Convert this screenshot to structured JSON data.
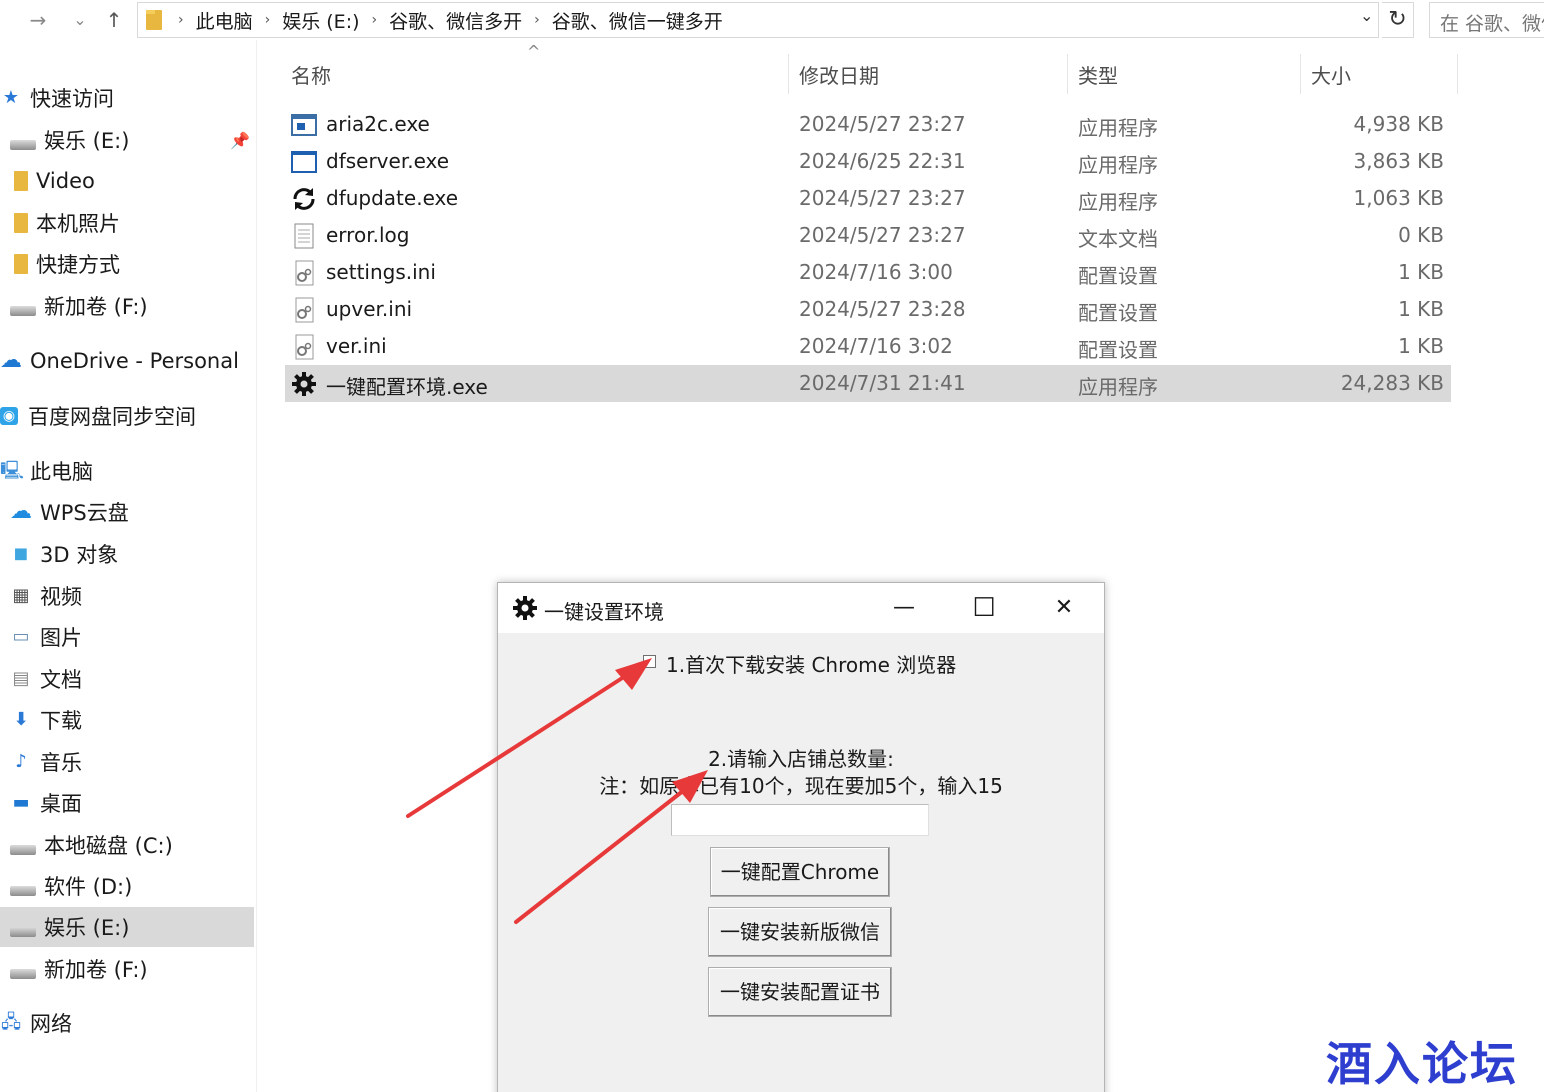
{
  "addressbar": {
    "back_icon": "→",
    "dropdown_icon": "⌄",
    "up_icon": "↑",
    "breadcrumbs": [
      "此电脑",
      "娱乐 (E:)",
      "谷歌、微信多开",
      "谷歌、微信一键多开"
    ],
    "search_placeholder": "在 谷歌、微信"
  },
  "sidebar": {
    "quick_access": "快速访问",
    "items": [
      {
        "label": "娱乐 (E:)",
        "icon": "drive-icon"
      },
      {
        "label": "Video",
        "icon": "folder-icon"
      },
      {
        "label": "本机照片",
        "icon": "folder-icon"
      },
      {
        "label": "快捷方式",
        "icon": "folder-icon"
      },
      {
        "label": "新加卷 (F:)",
        "icon": "drive-icon"
      },
      {
        "label": "OneDrive - Personal",
        "icon": "cloud-icon"
      },
      {
        "label": "百度网盘同步空间",
        "icon": "baidu-icon"
      },
      {
        "label": "此电脑",
        "icon": "computer-icon"
      },
      {
        "label": "WPS云盘",
        "icon": "cloud-icon"
      },
      {
        "label": "3D 对象",
        "icon": "cube-icon"
      },
      {
        "label": "视频",
        "icon": "video-icon"
      },
      {
        "label": "图片",
        "icon": "picture-icon"
      },
      {
        "label": "文档",
        "icon": "document-icon"
      },
      {
        "label": "下载",
        "icon": "download-icon"
      },
      {
        "label": "音乐",
        "icon": "music-icon"
      },
      {
        "label": "桌面",
        "icon": "desktop-icon"
      },
      {
        "label": "本地磁盘 (C:)",
        "icon": "drive-icon"
      },
      {
        "label": "软件 (D:)",
        "icon": "drive-icon"
      },
      {
        "label": "娱乐 (E:)",
        "icon": "drive-icon",
        "selected": true
      },
      {
        "label": "新加卷 (F:)",
        "icon": "drive-icon"
      },
      {
        "label": "网络",
        "icon": "network-icon"
      }
    ]
  },
  "columns": {
    "name": "名称",
    "date": "修改日期",
    "type": "类型",
    "size": "大小"
  },
  "files": [
    {
      "name": "aria2c.exe",
      "date": "2024/5/27 23:27",
      "type": "应用程序",
      "size": "4,938 KB",
      "icon": "app-window-icon"
    },
    {
      "name": "dfserver.exe",
      "date": "2024/6/25 22:31",
      "type": "应用程序",
      "size": "3,863 KB",
      "icon": "app-window-icon"
    },
    {
      "name": "dfupdate.exe",
      "date": "2024/5/27 23:27",
      "type": "应用程序",
      "size": "1,063 KB",
      "icon": "refresh-icon"
    },
    {
      "name": "error.log",
      "date": "2024/5/27 23:27",
      "type": "文本文档",
      "size": "0 KB",
      "icon": "text-file-icon"
    },
    {
      "name": "settings.ini",
      "date": "2024/7/16 3:00",
      "type": "配置设置",
      "size": "1 KB",
      "icon": "settings-file-icon"
    },
    {
      "name": "upver.ini",
      "date": "2024/5/27 23:28",
      "type": "配置设置",
      "size": "1 KB",
      "icon": "settings-file-icon"
    },
    {
      "name": "ver.ini",
      "date": "2024/7/16 3:02",
      "type": "配置设置",
      "size": "1 KB",
      "icon": "settings-file-icon"
    },
    {
      "name": "一键配置环境.exe",
      "date": "2024/7/31 21:41",
      "type": "应用程序",
      "size": "24,283 KB",
      "icon": "gear-icon",
      "selected": true
    }
  ],
  "dialog": {
    "title": "一键设置环境",
    "minimize": "—",
    "maximize": "☐",
    "close": "✕",
    "checkbox_label": "1.首次下载安装 Chrome 浏览器",
    "checkbox_checked": false,
    "prompt_line1": "2.请输入店铺总数量:",
    "prompt_line2": "注：如原本已有10个，现在要加5个，输入15",
    "input_value": "",
    "btn_chrome": "一键配置Chrome",
    "btn_wechat": "一键安装新版微信",
    "btn_cert": "一键安装配置证书"
  },
  "watermark": "酒入论坛",
  "colors": {
    "selected_bg": "#d9d9d9",
    "arrow": "#e8393a",
    "watermark": "#2e3fd0",
    "star": "#2b79d6"
  }
}
